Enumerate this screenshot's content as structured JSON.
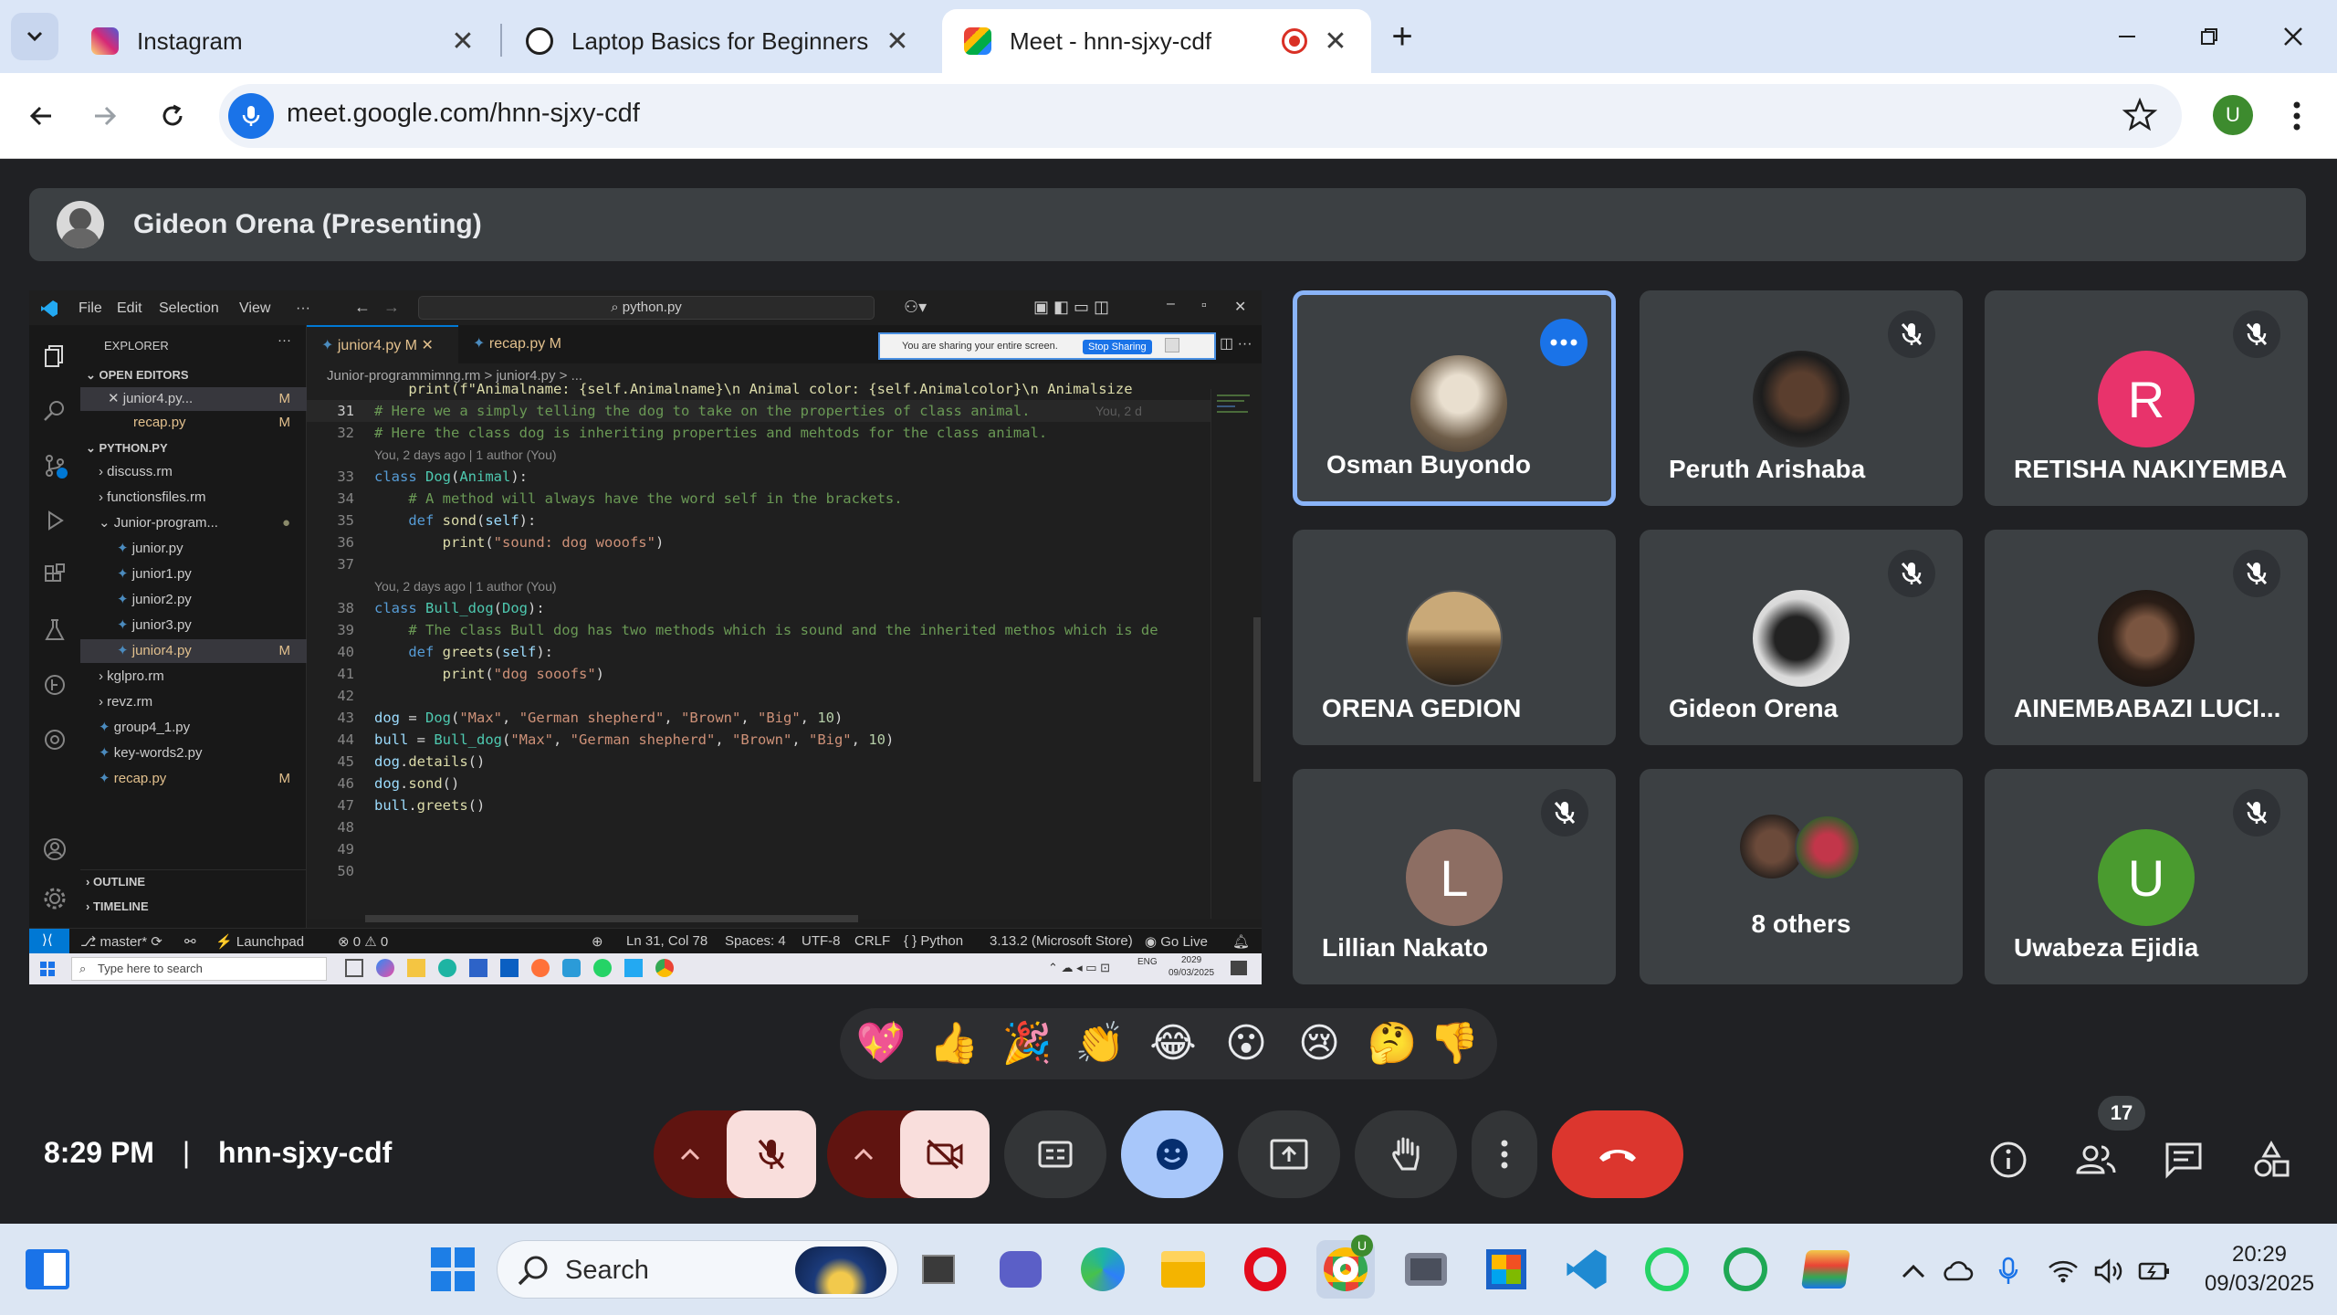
{
  "browser": {
    "tabs": [
      {
        "label": "Instagram",
        "favicon_color": "#d62976"
      },
      {
        "label": "Laptop Basics for Beginners",
        "favicon_color": "#1f1f1f"
      },
      {
        "label": "Meet - hnn-sjxy-cdf",
        "favicon_color": "#00ac47"
      }
    ],
    "url": "meet.google.com/hnn-sjxy-cdf",
    "profile_initial": "U"
  },
  "meet": {
    "presenter_label": "Gideon Orena (Presenting)",
    "time": "8:29 PM",
    "separator": "|",
    "meeting_code": "hnn-sjxy-cdf",
    "participant_count": "17",
    "participants": [
      {
        "name": "Osman Buyondo",
        "avatar": "photo",
        "speaking": true
      },
      {
        "name": "Peruth Arishaba",
        "avatar": "photo"
      },
      {
        "name": "RETISHA NAKIYEMBA",
        "avatar_letter": "R",
        "avatar_color": "#e8336b"
      },
      {
        "name": "ORENA GEDION",
        "avatar": "photo"
      },
      {
        "name": "Gideon Orena",
        "avatar": "photo"
      },
      {
        "name": "AINEMBABAZI LUCI...",
        "avatar": "photo"
      },
      {
        "name": "Lillian Nakato",
        "avatar_letter": "L",
        "avatar_color": "#8d6e63"
      },
      {
        "name": "8 others"
      },
      {
        "name": "Uwabeza Ejidia",
        "avatar_letter": "U",
        "avatar_color": "#4a9b2f"
      }
    ],
    "reactions": [
      "💖",
      "👍",
      "🎉",
      "👏",
      "😂",
      "😮",
      "😢",
      "🤔",
      "👎"
    ]
  },
  "vscode": {
    "menu": [
      "File",
      "Edit",
      "Selection",
      "View",
      "···"
    ],
    "search": "python.py",
    "share_banner": "You are sharing your entire screen.",
    "stop_sharing": "Stop Sharing",
    "explorer": {
      "title": "EXPLORER",
      "open_editors": "OPEN EDITORS",
      "project": "PYTHON.PY",
      "open_files": [
        {
          "label": "✕  junior4.py...",
          "mod": "M"
        },
        {
          "label": "recap.py",
          "mod": "M"
        }
      ],
      "files": [
        {
          "label": "discuss.rm",
          "mod": ""
        },
        {
          "label": "functionsfiles.rm",
          "mod": ""
        },
        {
          "label": "Junior-program...",
          "mod": "●"
        },
        {
          "label": "junior.py",
          "mod": ""
        },
        {
          "label": "junior1.py",
          "mod": ""
        },
        {
          "label": "junior2.py",
          "mod": ""
        },
        {
          "label": "junior3.py",
          "mod": ""
        },
        {
          "label": "junior4.py",
          "mod": "M"
        },
        {
          "label": "kglpro.rm",
          "mod": ""
        },
        {
          "label": "revz.rm",
          "mod": ""
        },
        {
          "label": "group4_1.py",
          "mod": ""
        },
        {
          "label": "key-words2.py",
          "mod": ""
        },
        {
          "label": "recap.py",
          "mod": "M"
        }
      ],
      "outline": "OUTLINE",
      "timeline": "TIMELINE"
    },
    "tabs": [
      "junior4.py  M  ✕",
      "recap.py  M"
    ],
    "breadcrumb": "Junior-programmimng.rm  >  junior4.py  >  ...",
    "blame": "You, 2 days ago | 1 author (You)",
    "inline_blame": "You, 2 d",
    "code": [
      {
        "n": "31",
        "t": "# Here we a simply telling the dog to take on the properties of class animal.",
        "c": "cm"
      },
      {
        "n": "32",
        "t": "# Here the class dog is inheriting properties and mehtods for the class animal.",
        "c": "cm"
      },
      {
        "n": "33",
        "t": "class Dog(Animal):",
        "c": "kw"
      },
      {
        "n": "34",
        "t": "    # A method will always have the word self in the brackets.",
        "c": "cm"
      },
      {
        "n": "35",
        "t": "    def sond(self):",
        "c": "kw"
      },
      {
        "n": "36",
        "t": "        print(\"sound: dog wooofs\")",
        "c": "fn"
      },
      {
        "n": "37",
        "t": "",
        "c": "df"
      },
      {
        "n": "38",
        "t": "class Bull_dog(Dog):",
        "c": "kw"
      },
      {
        "n": "39",
        "t": "    # The class Bull dog has two methods which is sound and the inherited methos which is de",
        "c": "cm"
      },
      {
        "n": "40",
        "t": "    def greets(self):",
        "c": "kw"
      },
      {
        "n": "41",
        "t": "        print(\"dog sooofs\")",
        "c": "fn"
      },
      {
        "n": "42",
        "t": "",
        "c": "df"
      },
      {
        "n": "43",
        "t": "dog = Dog(\"Max\", \"German shepherd\", \"Brown\", \"Big\", 10)",
        "c": "var"
      },
      {
        "n": "44",
        "t": "bull = Bull_dog(\"Max\", \"German shepherd\", \"Brown\", \"Big\", 10)",
        "c": "var"
      },
      {
        "n": "45",
        "t": "dog.details()",
        "c": "var"
      },
      {
        "n": "46",
        "t": "dog.sond()",
        "c": "var"
      },
      {
        "n": "47",
        "t": "bull.greets()",
        "c": "var"
      },
      {
        "n": "48",
        "t": "",
        "c": "df"
      },
      {
        "n": "49",
        "t": "",
        "c": "df"
      },
      {
        "n": "50",
        "t": "",
        "c": "df"
      }
    ],
    "status": {
      "branch": "master*",
      "launchpad": "Launchpad",
      "problems": "⊗ 0 ⚠ 0",
      "position": "Ln 31, Col 78",
      "spaces": "Spaces: 4",
      "encoding": "UTF-8",
      "eol": "CRLF",
      "language": "{ }  Python",
      "interpreter": "3.13.2 (Microsoft Store)",
      "golive": "Go Live"
    },
    "inner_search": "Type here to search",
    "inner_clock": "2029",
    "inner_date": "09/03/2025",
    "inner_lang": "ENG"
  },
  "taskbar": {
    "search": "Search",
    "time": "20:29",
    "date": "09/03/2025"
  }
}
